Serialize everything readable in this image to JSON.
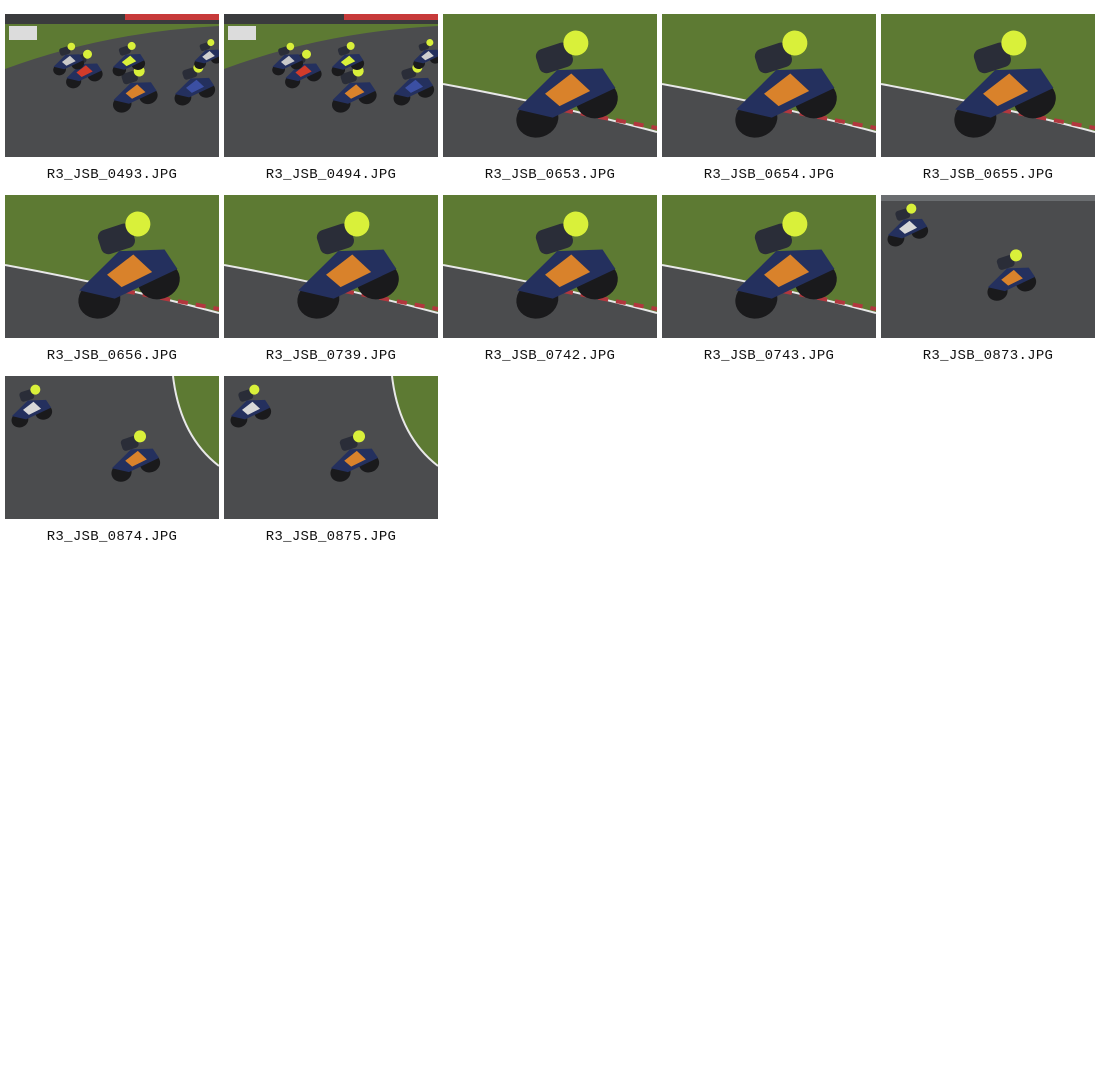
{
  "gallery": {
    "items": [
      {
        "filename": "R3_JSB_0493.JPG",
        "scene": "pack",
        "track": "track-left"
      },
      {
        "filename": "R3_JSB_0494.JPG",
        "scene": "pack",
        "track": "track-left"
      },
      {
        "filename": "R3_JSB_0653.JPG",
        "scene": "closeup",
        "track": "grass-top"
      },
      {
        "filename": "R3_JSB_0654.JPG",
        "scene": "closeup",
        "track": "grass-top"
      },
      {
        "filename": "R3_JSB_0655.JPG",
        "scene": "closeup",
        "track": "grass-top"
      },
      {
        "filename": "R3_JSB_0656.JPG",
        "scene": "closeup",
        "track": "grass-top"
      },
      {
        "filename": "R3_JSB_0739.JPG",
        "scene": "closeup",
        "track": "grass-top"
      },
      {
        "filename": "R3_JSB_0742.JPG",
        "scene": "closeup",
        "track": "grass-top"
      },
      {
        "filename": "R3_JSB_0743.JPG",
        "scene": "closeup",
        "track": "grass-top"
      },
      {
        "filename": "R3_JSB_0873.JPG",
        "scene": "corner",
        "track": "asphalt"
      },
      {
        "filename": "R3_JSB_0874.JPG",
        "scene": "corner",
        "track": "grass-right"
      },
      {
        "filename": "R3_JSB_0875.JPG",
        "scene": "corner",
        "track": "grass-right"
      }
    ]
  },
  "colors": {
    "asphalt": "#4b4c4e",
    "grass": "#5d7a33",
    "bike_blue": "#24305e",
    "bike_orange": "#d9822b",
    "helmet_yellow": "#d9f03a"
  }
}
